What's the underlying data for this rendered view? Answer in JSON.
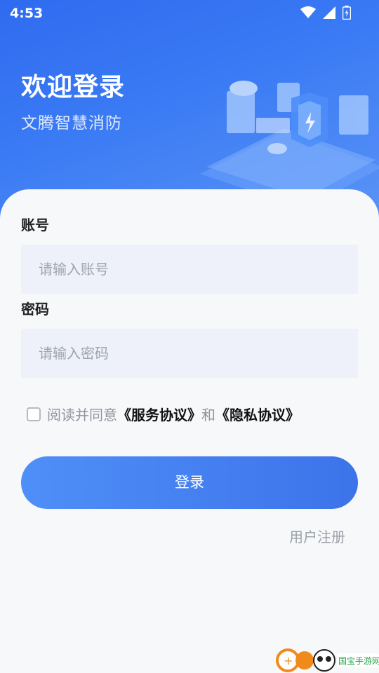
{
  "status_bar": {
    "time": "4:53"
  },
  "hero": {
    "title": "欢迎登录",
    "subtitle": "文腾智慧消防"
  },
  "form": {
    "account_label": "账号",
    "account_placeholder": "请输入账号",
    "password_label": "密码",
    "password_placeholder": "请输入密码",
    "agree_prefix": "阅读并同意",
    "service_link": "《服务协议》",
    "and_text": "和",
    "privacy_link": "《隐私协议》",
    "agree_checked": false,
    "login_button": "登录",
    "register_link": "用户注册"
  },
  "colors": {
    "primary": "#3c73ea",
    "hero_start": "#2f6bf0",
    "input_bg": "#eef1fa"
  },
  "icons": [
    "wifi-icon",
    "cellular-signal-icon",
    "battery-icon",
    "checkbox-icon"
  ],
  "watermark": {
    "text": "国宝手游网"
  }
}
